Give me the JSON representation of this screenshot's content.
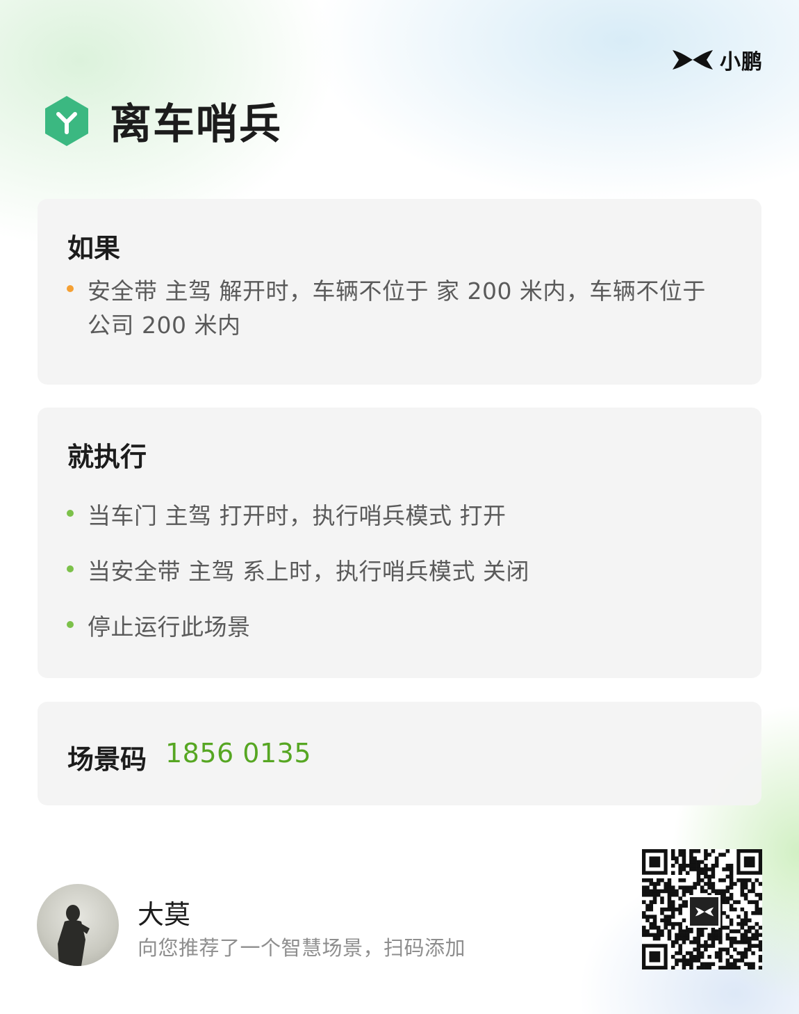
{
  "brand": {
    "name": "小鹏",
    "logo_icon": "xpeng-logo-icon"
  },
  "header": {
    "title": "离车哨兵",
    "icon": "hexagon-y-icon",
    "icon_color": "#3bb881"
  },
  "if_card": {
    "title": "如果",
    "conditions": [
      {
        "text": "安全带 主驾 解开时，车辆不位于 家 200 米内，车辆不位于 公司 200 米内",
        "dot_color": "#f5a033"
      }
    ]
  },
  "then_card": {
    "title": "就执行",
    "actions": [
      {
        "text": "当车门 主驾 打开时，执行哨兵模式 打开",
        "dot_color": "#7cc14a"
      },
      {
        "text": "当安全带 主驾 系上时，执行哨兵模式 关闭",
        "dot_color": "#7cc14a"
      },
      {
        "text": "停止运行此场景",
        "dot_color": "#7cc14a"
      }
    ]
  },
  "scene_code": {
    "label": "场景码",
    "value": "1856 0135",
    "value_color": "#56a622"
  },
  "footer": {
    "user_name": "大莫",
    "message": "向您推荐了一个智慧场景，扫码添加",
    "qr_icon": "qr-code-icon"
  }
}
